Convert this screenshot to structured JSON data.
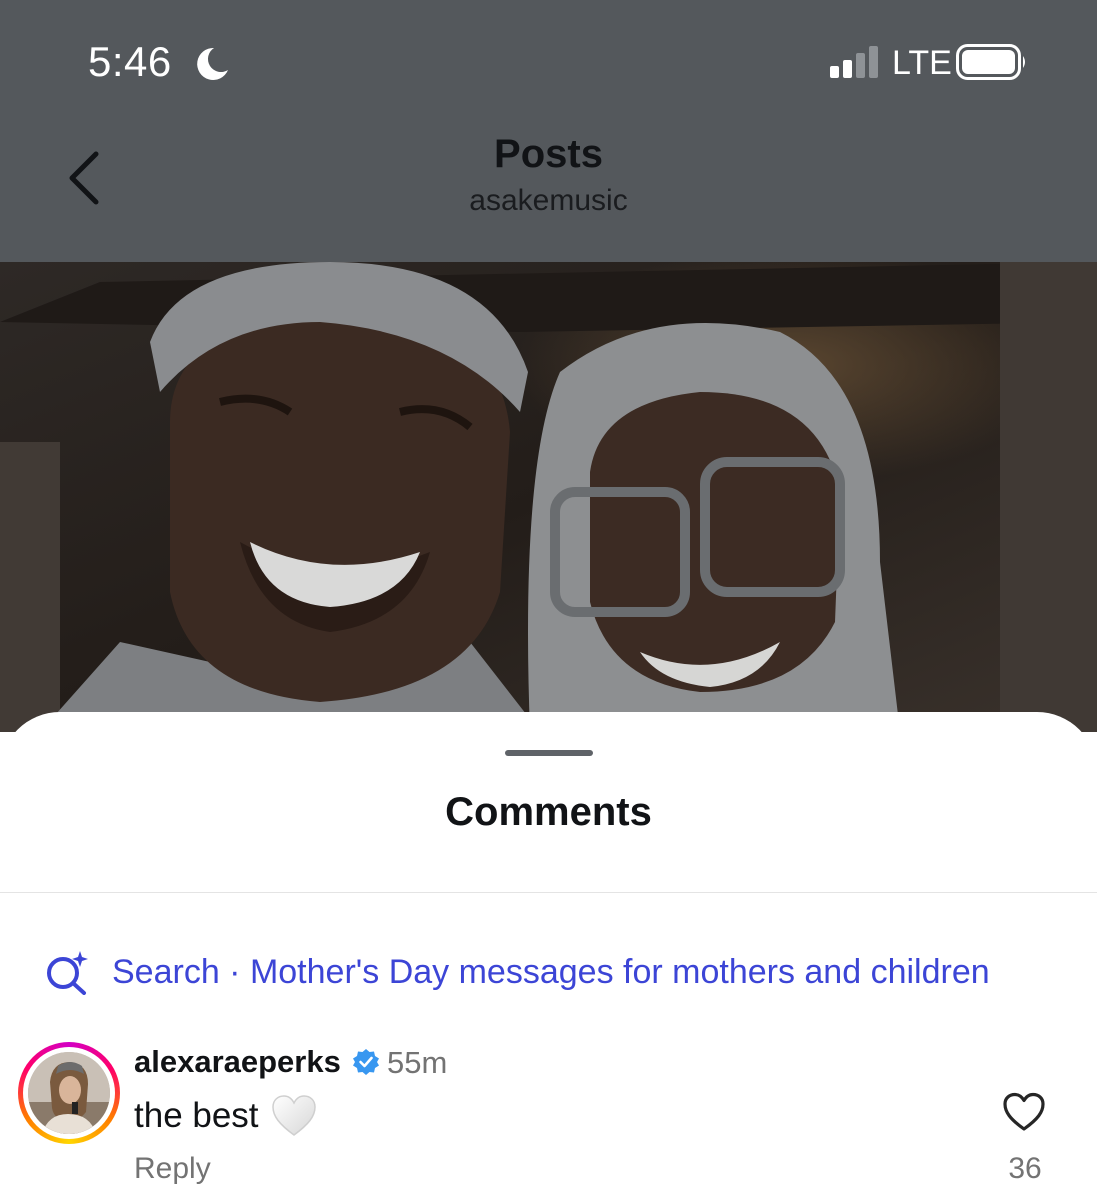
{
  "status_bar": {
    "time": "5:46",
    "network": "LTE",
    "icons": [
      "moon-icon",
      "signal-icon",
      "battery-icon"
    ]
  },
  "nav": {
    "title": "Posts",
    "subtitle": "asakemusic",
    "back_icon": "chevron-left-icon"
  },
  "post": {
    "image": "photo of two smiling people"
  },
  "comments_sheet": {
    "title": "Comments",
    "search": {
      "label": "Search · Mother's Day messages for mothers and children",
      "icon": "search-sparkle-icon"
    },
    "comments": [
      {
        "username": "alexaraeperks",
        "verified": true,
        "time": "55m",
        "text": "the best",
        "emoji": "white-heart",
        "reply_label": "Reply",
        "like_count": "36"
      }
    ]
  },
  "colors": {
    "header_bg": "#54585c",
    "link_blue": "#3c45d6",
    "verified_blue": "#3897f0",
    "muted_text": "#737373"
  }
}
